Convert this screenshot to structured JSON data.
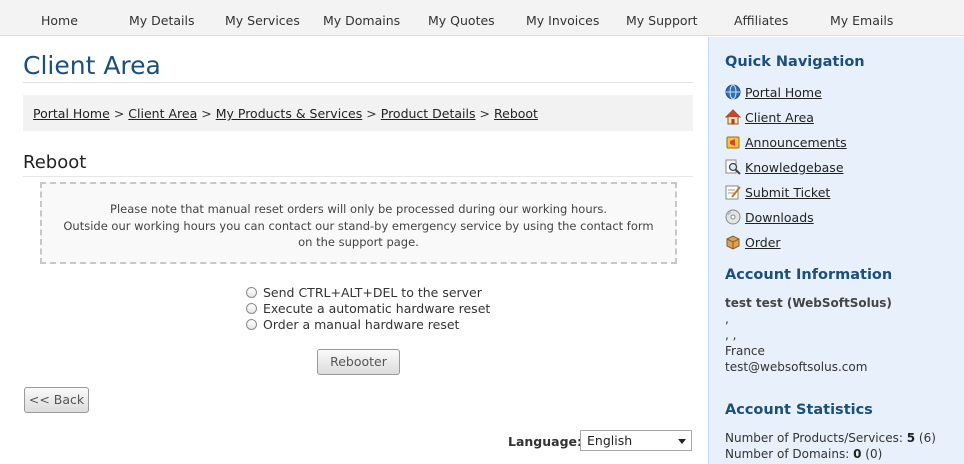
{
  "topnav": {
    "items": [
      "Home",
      "My Details",
      "My Services",
      "My Domains",
      "My Quotes",
      "My Invoices",
      "My Support",
      "Affiliates",
      "My Emails"
    ]
  },
  "main": {
    "title": "Client Area",
    "breadcrumb": [
      "Portal Home",
      "Client Area",
      "My Products & Services",
      "Product Details",
      "Reboot"
    ],
    "breadcrumb_separator": ">",
    "section_heading": "Reboot",
    "notice_lines": [
      "Please note that manual reset orders will only be processed during our working hours.",
      "Outside our working hours you can contact our stand-by emergency service by using the contact form",
      "on the support page."
    ],
    "options": [
      "Send CTRL+ALT+DEL to the server",
      "Execute a automatic hardware reset",
      "Order a manual hardware reset"
    ],
    "reboot_button": "Rebooter",
    "back_button": "<< Back",
    "language_label": "Language:",
    "language_value": "English"
  },
  "sidebar": {
    "quick_nav_heading": "Quick Navigation",
    "quick_nav": [
      {
        "label": "Portal Home",
        "icon": "globe-icon"
      },
      {
        "label": "Client Area",
        "icon": "house-icon"
      },
      {
        "label": "Announcements",
        "icon": "megaphone-icon"
      },
      {
        "label": "Knowledgebase",
        "icon": "magnifier-icon"
      },
      {
        "label": "Submit Ticket",
        "icon": "ticket-icon"
      },
      {
        "label": "Downloads",
        "icon": "disc-icon"
      },
      {
        "label": "Order",
        "icon": "box-icon"
      }
    ],
    "account_heading": "Account Information",
    "account": {
      "name": "test test (WebSoftSolus)",
      "line1": ",",
      "line2": ", ,",
      "country": "France",
      "email": "test@websoftsolus.com"
    },
    "stats_heading": "Account Statistics",
    "stats": {
      "products_label": "Number of Products/Services:",
      "products_value": "5",
      "products_total": "(6)",
      "domains_label": "Number of Domains:",
      "domains_value": "0",
      "domains_total": "(0)"
    }
  },
  "colors": {
    "accent_blue": "#1b4f7e",
    "sidebar_bg": "#e8f1fb"
  }
}
